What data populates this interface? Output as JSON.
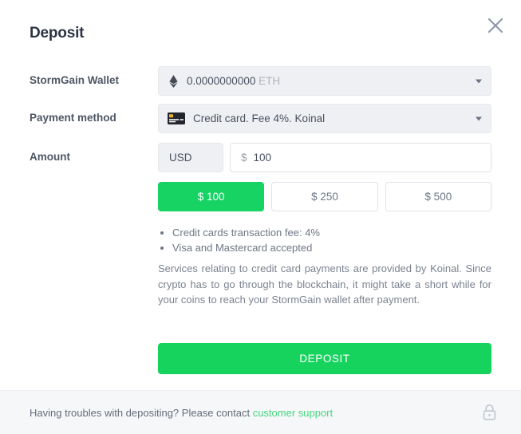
{
  "modal": {
    "title": "Deposit",
    "close_icon": "close-icon"
  },
  "fields": {
    "wallet": {
      "label": "StormGain Wallet",
      "icon": "ethereum-icon",
      "balance": "0.0000000000",
      "currency": "ETH"
    },
    "payment_method": {
      "label": "Payment method",
      "icon": "credit-card-icon",
      "value": "Credit card. Fee 4%. Koinal"
    },
    "amount": {
      "label": "Amount",
      "currency": "USD",
      "sign": "$",
      "value": "100",
      "placeholder": "100"
    }
  },
  "presets": [
    {
      "label": "$ 100",
      "active": true
    },
    {
      "label": "$ 250",
      "active": false
    },
    {
      "label": "$ 500",
      "active": false
    }
  ],
  "info_list": [
    "Credit cards transaction fee: 4%",
    "Visa and Mastercard accepted"
  ],
  "disclaimer": "Services relating to credit card payments are provided by Koinal. Since crypto has to go through the blockchain, it might take a short while for your coins to reach your StormGain wallet after payment.",
  "submit": {
    "label": "DEPOSIT"
  },
  "footer": {
    "text": "Having troubles with depositing? Please contact",
    "link": "customer support",
    "lock_icon": "lock-icon"
  },
  "colors": {
    "accent_green": "#16d35e",
    "preset_active": "#16d364",
    "link_green": "#44d67e",
    "field_bg": "#eef0f3",
    "footer_bg": "#f6f7f9",
    "title": "#2c3345"
  }
}
